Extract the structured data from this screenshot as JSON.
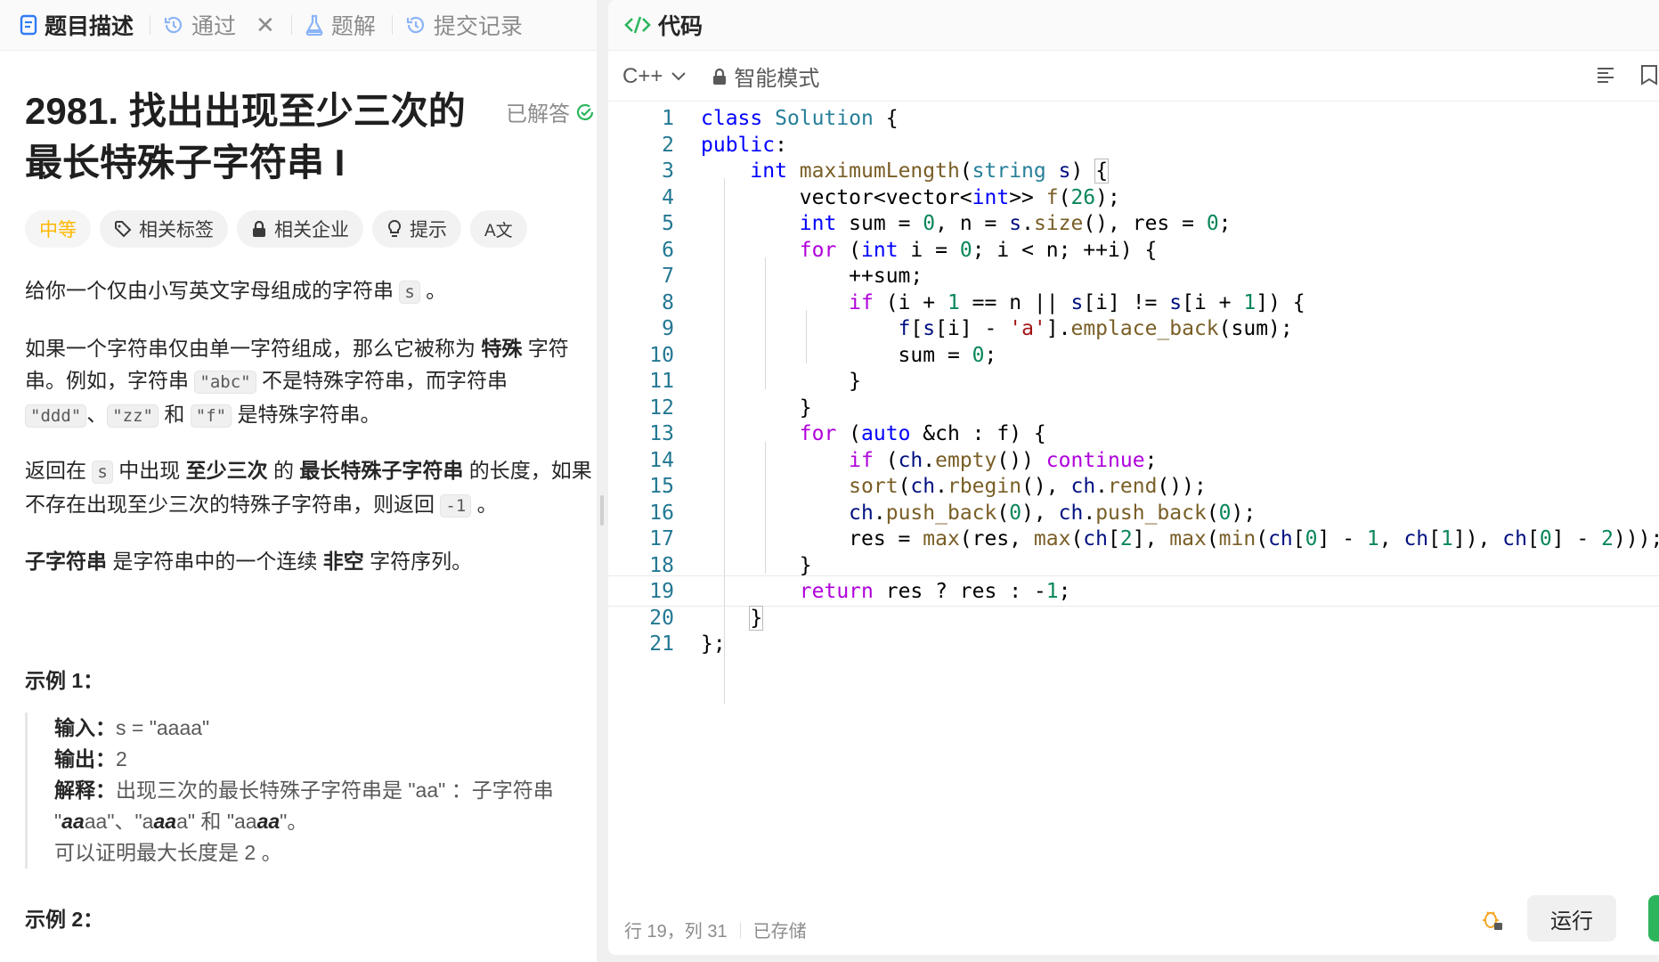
{
  "left_tabs": [
    {
      "label": "题目描述",
      "icon": "description-icon",
      "active": true
    },
    {
      "label": "通过",
      "icon": "history-icon",
      "active": false
    },
    {
      "label": "题解",
      "icon": "flask-icon",
      "active": false
    },
    {
      "label": "提交记录",
      "icon": "history-icon",
      "active": false
    }
  ],
  "problem": {
    "title_line1": "2981. 找出出现至少三次的",
    "title_line2": "最长特殊子字符串 I",
    "status": "已解答",
    "tags": {
      "difficulty": "中等",
      "related_tags": "相关标签",
      "related_companies": "相关企业",
      "hint": "提示",
      "translate": "A文"
    },
    "p1_a": "给你一个仅由小写英文字母组成的字符串",
    "p1_code": "s",
    "p1_b": "。",
    "p2_a": "如果一个字符串仅由单一字符组成，那么它被称为",
    "p2_bold": "特殊",
    "p2_b": "字符串。例如，字符串",
    "p2_code1": "\"abc\"",
    "p2_c": "不是特殊字符串，而字符串",
    "p2_code2": "\"ddd\"",
    "p2_d": "、",
    "p2_code3": "\"zz\"",
    "p2_e": "和",
    "p2_code4": "\"f\"",
    "p2_f": "是特殊字符串。",
    "p3_a": "返回在",
    "p3_code1": "s",
    "p3_b": "中出现",
    "p3_bold1": "至少三次",
    "p3_c": "的",
    "p3_bold2": "最长特殊子字符串",
    "p3_d": "的长度，如果不存在出现至少三次的特殊子字符串，则返回",
    "p3_code2": "-1",
    "p3_e": "。",
    "p4_bold1": "子字符串",
    "p4_a": "是字符串中的一个连续",
    "p4_bold2": "非空",
    "p4_b": "字符序列。",
    "example1_heading": "示例 1：",
    "example1": {
      "input_label": "输入：",
      "input_value": "s = \"aaaa\"",
      "output_label": "输出：",
      "output_value": "2",
      "explain_label": "解释：",
      "explain_a": "出现三次的最长特殊子字符串是 \"aa\" ：子字符串 \"",
      "explain_i1": "aa",
      "explain_b": "aa\"、\"a",
      "explain_i2": "aa",
      "explain_c": "a\" 和 \"aa",
      "explain_i3": "aa",
      "explain_d": "\"。",
      "explain_e": "可以证明最大长度是 2 。"
    },
    "example2_heading": "示例 2："
  },
  "editor": {
    "header_title": "代码",
    "language": "C++",
    "mode": "智能模式",
    "line_numbers": [
      "1",
      "2",
      "3",
      "4",
      "5",
      "6",
      "7",
      "8",
      "9",
      "10",
      "11",
      "12",
      "13",
      "14",
      "15",
      "16",
      "17",
      "18",
      "19",
      "20",
      "21"
    ],
    "status_position": "行 19，列 31",
    "status_saved": "已存储",
    "run_label": "运行"
  },
  "colors": {
    "keyword": "#0000ff",
    "control": "#af00db",
    "type": "#267f99",
    "function": "#795e26",
    "number": "#098658",
    "string": "#a31515",
    "difficulty_medium": "#ffb800",
    "submit_green": "#2db55d"
  }
}
